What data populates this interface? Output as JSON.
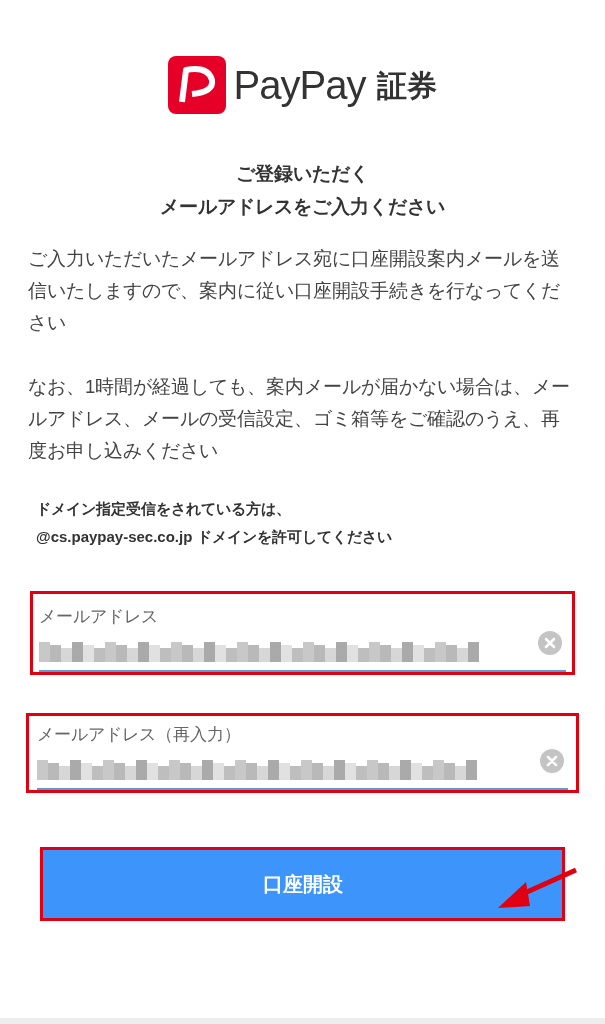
{
  "logo": {
    "brand": "PayPay",
    "suffix": "証券"
  },
  "heading": [
    "ご登録いただく",
    "メールアドレスをご入力ください"
  ],
  "paragraphs": [
    "ご入力いただいたメールアドレス宛に口座開設案内メールを送信いたしますので、案内に従い口座開設手続きを行なってください",
    "なお、1時間が経過しても、案内メールが届かない場合は、メールアドレス、メールの受信設定、ゴミ箱等をご確認のうえ、再度お申し込みください"
  ],
  "note": [
    "ドメイン指定受信をされている方は、",
    "@cs.paypay-sec.co.jp ドメインを許可してください"
  ],
  "fields": [
    {
      "label": "メールアドレス"
    },
    {
      "label": "メールアドレス（再入力）"
    }
  ],
  "submit": {
    "label": "口座開設"
  }
}
